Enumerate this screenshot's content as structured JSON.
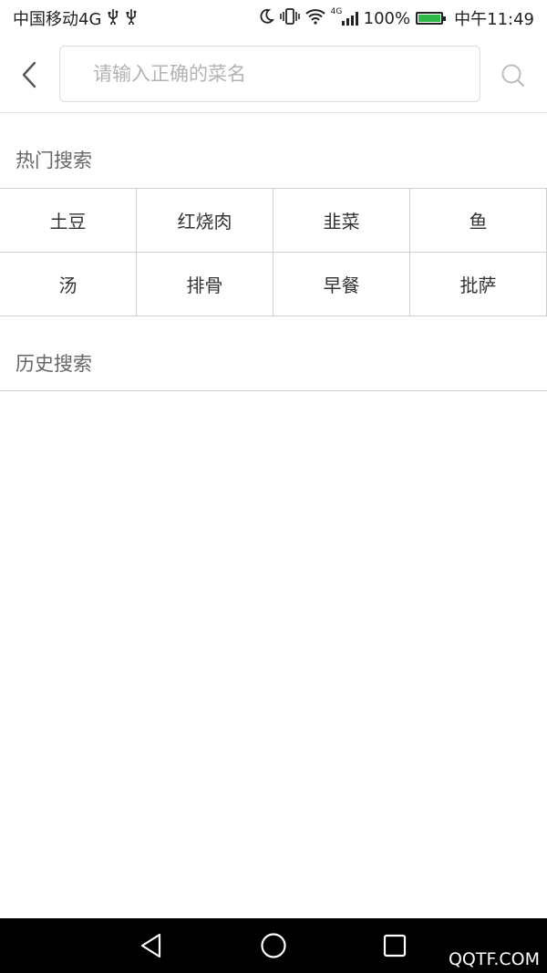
{
  "status_bar": {
    "carrier": "中国移动4G",
    "usb_icons": [
      "usb-icon",
      "usb-icon"
    ],
    "network_label": "4G",
    "battery_percent": "100%",
    "battery_level": 1.0,
    "time": "中午11:49"
  },
  "search": {
    "placeholder": "请输入正确的菜名",
    "value": ""
  },
  "hot_search": {
    "title": "热门搜索",
    "items": [
      {
        "label": "土豆"
      },
      {
        "label": "红烧肉"
      },
      {
        "label": "韭菜"
      },
      {
        "label": "鱼"
      },
      {
        "label": "汤"
      },
      {
        "label": "排骨"
      },
      {
        "label": "早餐"
      },
      {
        "label": "批萨"
      }
    ]
  },
  "history_search": {
    "title": "历史搜索",
    "items": []
  },
  "watermark": "QQTF.COM",
  "colors": {
    "battery_fill": "#2fb84a",
    "divider": "#cfcfcf",
    "placeholder": "#b3b3b3",
    "section_title": "#666666"
  }
}
